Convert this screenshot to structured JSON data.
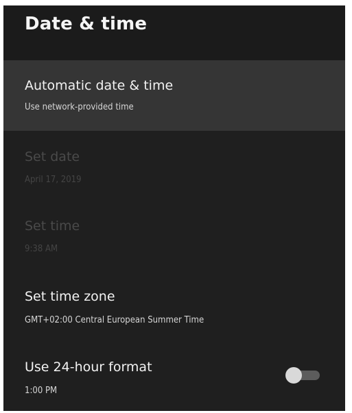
{
  "header": {
    "title": "Date & time"
  },
  "settings": {
    "items": [
      {
        "title": "Automatic date & time",
        "summary": "Use network-provided time",
        "focused": true,
        "enabled": true
      },
      {
        "title": "Set date",
        "summary": "April 17, 2019",
        "focused": false,
        "enabled": false
      },
      {
        "title": "Set time",
        "summary": "9:38 AM",
        "focused": false,
        "enabled": false
      },
      {
        "title": "Set time zone",
        "summary": "GMT+02:00 Central European Summer Time",
        "focused": false,
        "enabled": true
      },
      {
        "title": "Use 24-hour format",
        "summary": "1:00 PM",
        "focused": false,
        "enabled": true,
        "toggle_on": false
      }
    ]
  },
  "colors": {
    "background": "#1f1f1f",
    "header_background": "#1b1b1b",
    "focused_row": "#353535",
    "primary_text": "#f2f2f2",
    "secondary_text": "#d6d6d6",
    "disabled_text": "#4a4a4a",
    "toggle_track_off": "#5c5c5c",
    "toggle_thumb_off": "#d9d9d9"
  },
  "icons": {
    "toggle": "switch-off-icon"
  }
}
